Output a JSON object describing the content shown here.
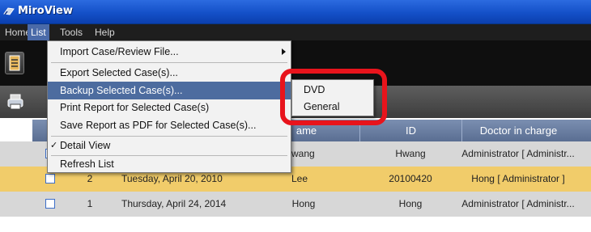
{
  "window": {
    "title": "MiroView"
  },
  "menubar": {
    "items": [
      "Home",
      "List",
      "Tools",
      "Help"
    ]
  },
  "list_menu": {
    "import_label": "Import Case/Review File...",
    "export_label": "Export Selected Case(s)...",
    "backup_label": "Backup Selected Case(s)...",
    "print_label": "Print Report for Selected Case(s)",
    "save_pdf_label": "Save Report as PDF for Selected Case(s)...",
    "detail_view_label": "Detail View",
    "refresh_label": "Refresh List",
    "check_mark": "✓"
  },
  "backup_submenu": {
    "dvd_label": "DVD",
    "general_label": "General"
  },
  "grid": {
    "columns": [
      "ame",
      "ID",
      "Doctor in charge"
    ],
    "rows": [
      {
        "no": "",
        "date": "",
        "name": "wang",
        "id": "Hwang",
        "doctor": "Administrator [ Administr..."
      },
      {
        "no": "2",
        "date": "Tuesday, April 20, 2010",
        "name": "Lee",
        "id": "20100420",
        "doctor": "Hong [ Administrator ]"
      },
      {
        "no": "1",
        "date": "Thursday, April 24, 2014",
        "name": "Hong",
        "id": "Hong",
        "doctor": "Administrator [ Administr..."
      }
    ]
  },
  "colors": {
    "accent": "#4d6c9f",
    "selected_row": "#f1cc6a",
    "highlight_ring": "#e8141c"
  },
  "icons": [
    "app-logo-icon",
    "list-view-icon",
    "print-icon",
    "submenu-arrow-icon",
    "check-icon"
  ]
}
